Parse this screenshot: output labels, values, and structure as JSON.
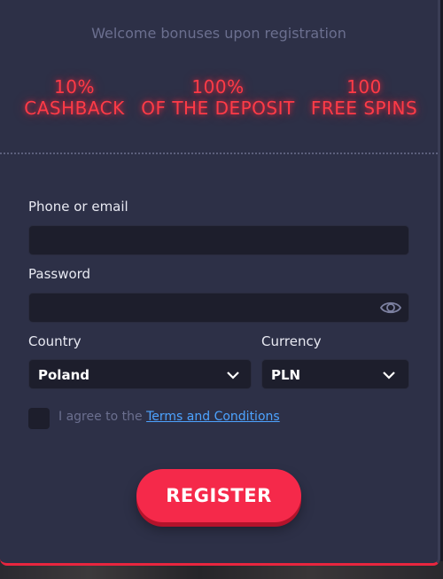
{
  "header": {
    "welcome_text": "Welcome bonuses upon registration"
  },
  "bonuses": [
    {
      "top": "10%",
      "bottom": "CASHBACK"
    },
    {
      "top": "100%",
      "bottom": "OF THE DEPOSIT"
    },
    {
      "top": "100",
      "bottom": "FREE SPINS"
    }
  ],
  "form": {
    "phone_label": "Phone or email",
    "phone_value": "",
    "password_label": "Password",
    "password_value": "",
    "country_label": "Country",
    "country_value": "Poland",
    "currency_label": "Currency",
    "currency_value": "PLN",
    "agree_prefix": "I agree to the",
    "terms_link": "Terms and Conditions",
    "register_label": "REGISTER"
  },
  "colors": {
    "panel_bg": "#2d3047",
    "accent_red": "#f5294a",
    "neon_red": "#ff3b47",
    "link_blue": "#4da3ff"
  },
  "icons": {
    "password_toggle": "eye-icon",
    "select_arrow": "chevron-down-icon"
  }
}
